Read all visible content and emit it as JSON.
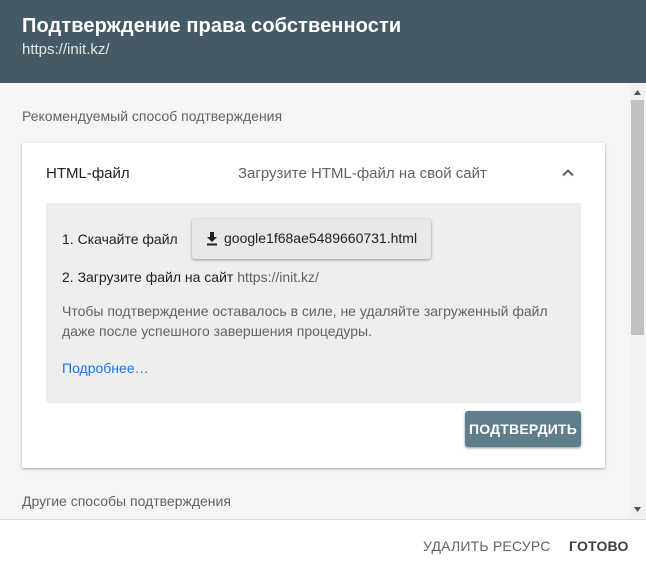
{
  "header": {
    "title": "Подтверждение права собственности",
    "subtitle": "https://init.kz/"
  },
  "recommended_label": "Рекомендуемый способ подтверждения",
  "method": {
    "name": "HTML-файл",
    "description": "Загрузите HTML-файл на свой сайт",
    "expand_icon": "chevron-up-icon",
    "step1_label": "1. Скачайте файл",
    "download_icon": "download-icon",
    "download_file": "google1f68ae5489660731.html",
    "step2_label": "2. Загрузите файл на сайт",
    "step2_url": "https://init.kz/",
    "note": "Чтобы подтверждение оставалось в силе, не удаляйте загруженный файл даже после успешного завершения процедуры.",
    "more_link": "Подробнее…",
    "confirm_label": "ПОДТВЕРДИТЬ"
  },
  "other_methods_label": "Другие способы подтверждения",
  "footer": {
    "delete_label": "УДАЛИТЬ РЕСУРС",
    "done_label": "ГОТОВО"
  },
  "colors": {
    "header_bg": "#455a64",
    "confirm_bg": "#607d8b",
    "link": "#1a73e8",
    "panel_bg": "#eeeeee"
  }
}
